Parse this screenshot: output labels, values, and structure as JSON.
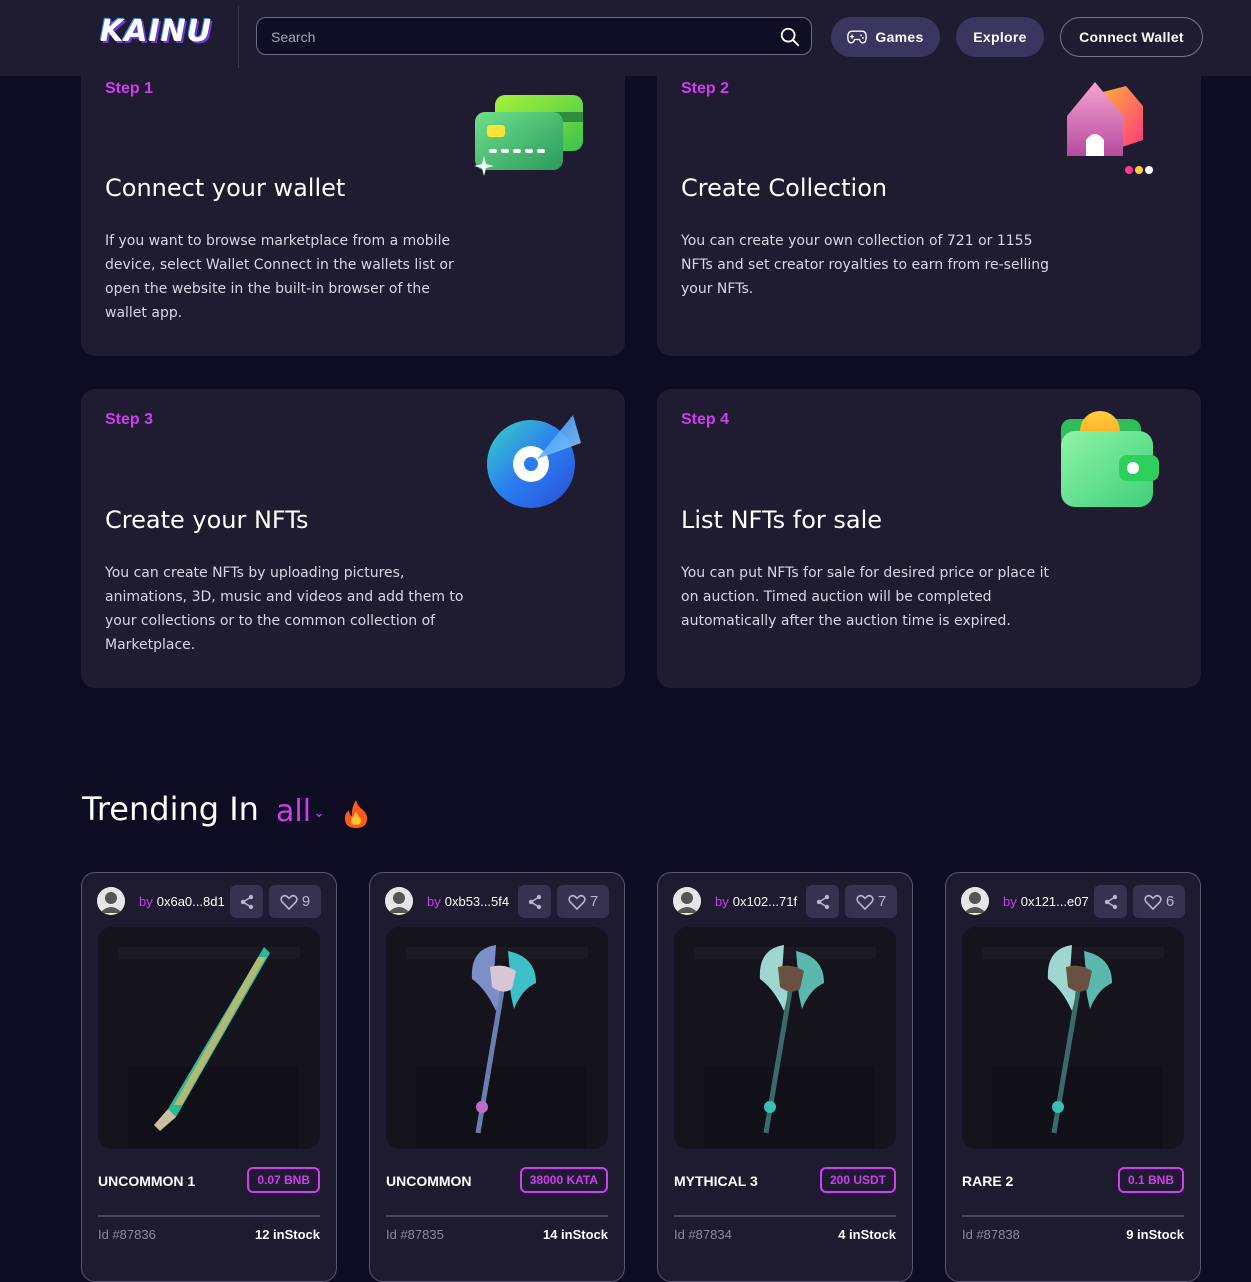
{
  "header": {
    "logo": "KAINU",
    "search": {
      "placeholder": "Search",
      "value": ""
    },
    "nav": {
      "games": "Games",
      "explore": "Explore",
      "connect_wallet": "Connect Wallet"
    }
  },
  "steps": [
    {
      "label": "Step 1",
      "title": "Connect your wallet",
      "description": "If you want to browse marketplace from a mobile device, select Wallet Connect in the wallets list or open the website in the built-in browser of the wallet app.",
      "icon": "credit-card-icon"
    },
    {
      "label": "Step 2",
      "title": "Create Collection",
      "description": "You can create your own collection of 721 or 1155 NFTs and set creator royalties to earn from re-selling your NFTs.",
      "icon": "collection-house-icon"
    },
    {
      "label": "Step 3",
      "title": "Create your NFTs",
      "description": "You can create NFTs by uploading pictures, animations, 3D, music and videos and add them to your collections or to the common collection of Marketplace.",
      "icon": "create-disc-icon"
    },
    {
      "label": "Step 4",
      "title": "List NFTs for sale",
      "description": "You can put NFTs for sale for desired price or place it on auction. Timed auction will be completed automatically after the auction time is expired.",
      "icon": "wallet-icon"
    }
  ],
  "trending": {
    "title": "Trending In",
    "filter": "all",
    "items": [
      {
        "owner": "0x6a0...8d1",
        "likes": "9",
        "name": "UNCOMMON 1",
        "price": "0.07 BNB",
        "id": "Id #87836",
        "stock": "12 inStock",
        "art": "sword"
      },
      {
        "owner": "0xb53...5f4",
        "likes": "7",
        "name": "UNCOMMON",
        "price": "38000 KATA",
        "id": "Id #87835",
        "stock": "14 inStock",
        "art": "axe-blue"
      },
      {
        "owner": "0x102...71f",
        "likes": "7",
        "name": "MYTHICAL 3",
        "price": "200 USDT",
        "id": "Id #87834",
        "stock": "4 inStock",
        "art": "axe-teal"
      },
      {
        "owner": "0x121...e07",
        "likes": "6",
        "name": "RARE 2",
        "price": "0.1 BNB",
        "id": "Id #87838",
        "stock": "9 inStock",
        "art": "axe-teal"
      }
    ],
    "by_label": "by"
  },
  "colors": {
    "accent": "#d03cf0",
    "card": "#1f1b30",
    "background": "#0e0c22"
  }
}
